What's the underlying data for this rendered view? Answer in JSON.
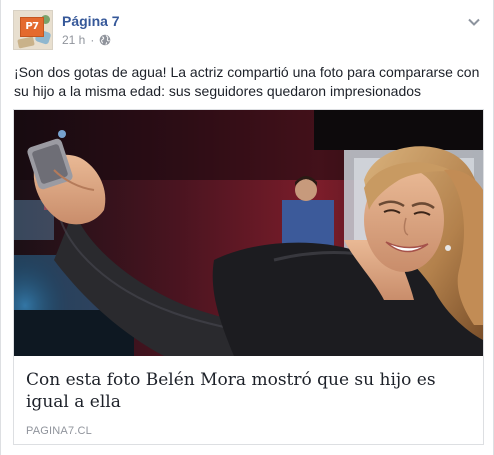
{
  "post": {
    "page_name": "Página 7",
    "avatar_text": "P7",
    "time": "21 h",
    "separator": "·",
    "text": "¡Son dos gotas de agua! La actriz compartió una foto para compararse con su hijo a la misma edad: sus seguidores quedaron impresionados"
  },
  "link": {
    "title": "Con esta foto Belén Mora mostró que su hijo es igual a ella",
    "domain": "PAGINA7.CL"
  },
  "colors": {
    "page_name": "#365899",
    "meta": "#90949c",
    "text": "#1d2129",
    "border": "#dddfe2"
  },
  "icons": {
    "privacy": "globe-icon",
    "options": "chevron-down-icon"
  }
}
